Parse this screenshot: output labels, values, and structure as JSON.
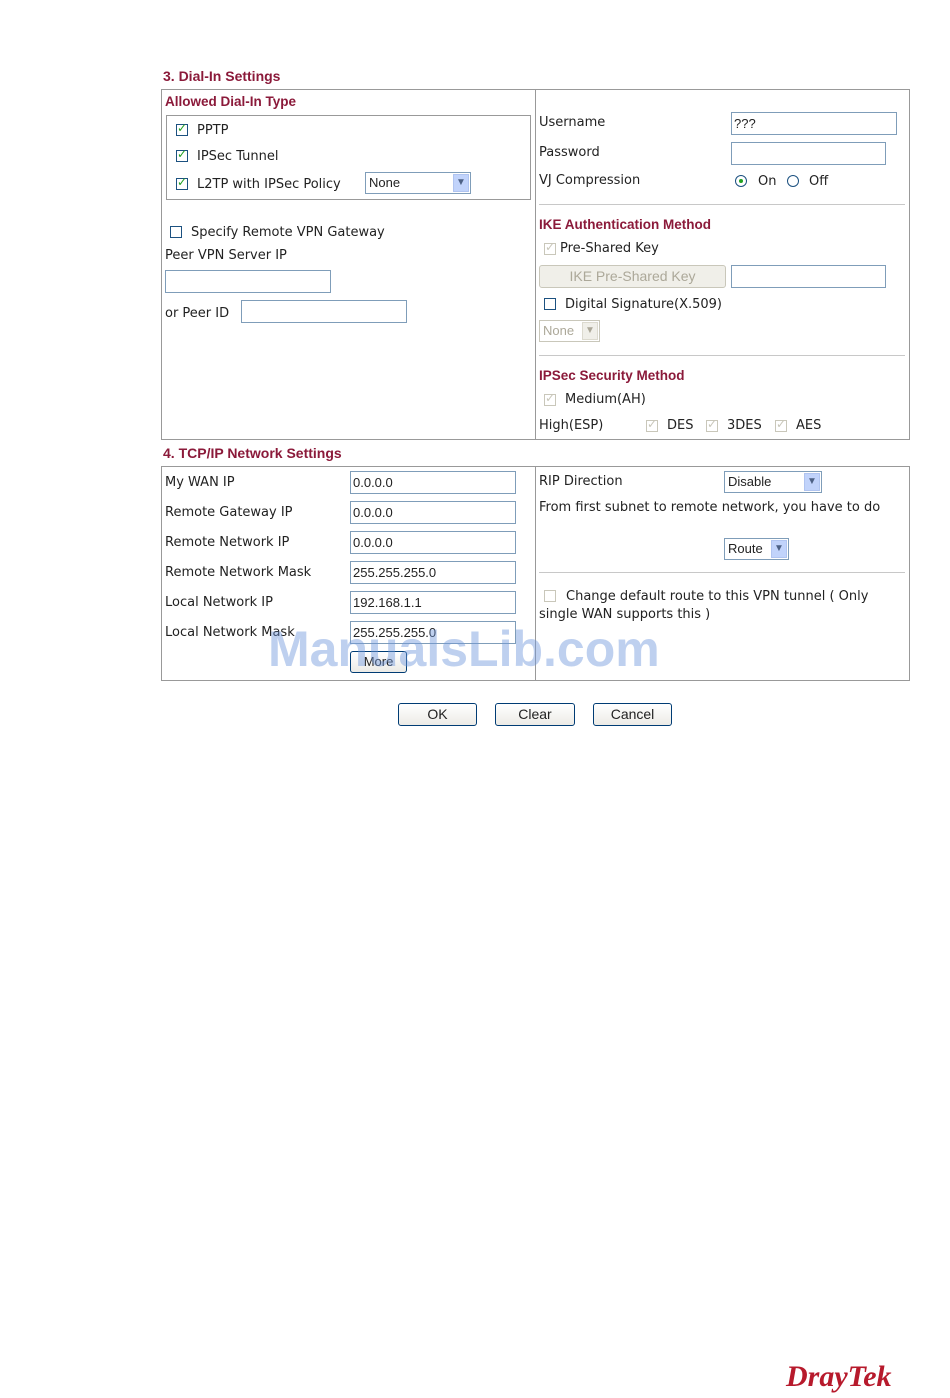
{
  "dial_in": {
    "title": "3. Dial-In Settings",
    "allowed_type_title": "Allowed Dial-In Type",
    "pptp_label": "PPTP",
    "pptp_checked": true,
    "ipsec_label": "IPSec Tunnel",
    "ipsec_checked": true,
    "l2tp_label": "L2TP with IPSec Policy",
    "l2tp_checked": true,
    "l2tp_policy_value": "None",
    "specify_gateway_label": "Specify Remote VPN Gateway",
    "specify_gateway_checked": false,
    "peer_server_ip_label": "Peer VPN Server IP",
    "peer_server_ip_value": "",
    "peer_id_label": "or Peer ID",
    "peer_id_value": "",
    "username_label": "Username",
    "username_value": "???",
    "password_label": "Password",
    "password_value": "",
    "vj_label": "VJ Compression",
    "vj_on_label": "On",
    "vj_off_label": "Off",
    "vj_selected": "On",
    "ike_title": "IKE Authentication Method",
    "pre_shared_label": "Pre-Shared Key",
    "ike_psk_button": "IKE Pre-Shared Key",
    "ike_psk_value": "",
    "digital_sig_label": "Digital Signature(X.509)",
    "digital_sig_value": "None",
    "ipsec_method_title": "IPSec Security Method",
    "medium_label": "Medium(AH)",
    "high_label": "High(ESP)",
    "des_label": "DES",
    "des3_label": "3DES",
    "aes_label": "AES"
  },
  "tcpip": {
    "title": "4. TCP/IP Network Settings",
    "my_wan_ip_label": "My WAN IP",
    "my_wan_ip_value": "0.0.0.0",
    "remote_gw_label": "Remote Gateway IP",
    "remote_gw_value": "0.0.0.0",
    "remote_net_label": "Remote Network IP",
    "remote_net_value": "0.0.0.0",
    "remote_mask_label": "Remote Network Mask",
    "remote_mask_value": "255.255.255.0",
    "local_net_label": "Local Network IP",
    "local_net_value": "192.168.1.1",
    "local_mask_label": "Local Network Mask",
    "local_mask_value": "255.255.255.0",
    "more_button": "More",
    "rip_label": "RIP Direction",
    "rip_value": "Disable",
    "subnet_text": "From first subnet to remote network, you have to do",
    "route_value": "Route",
    "default_route_label": "Change default route to this VPN tunnel ( Only single WAN supports this )"
  },
  "buttons": {
    "ok": "OK",
    "clear": "Clear",
    "cancel": "Cancel"
  },
  "watermark": "ManualsLib.com",
  "logo": "DrayTek"
}
